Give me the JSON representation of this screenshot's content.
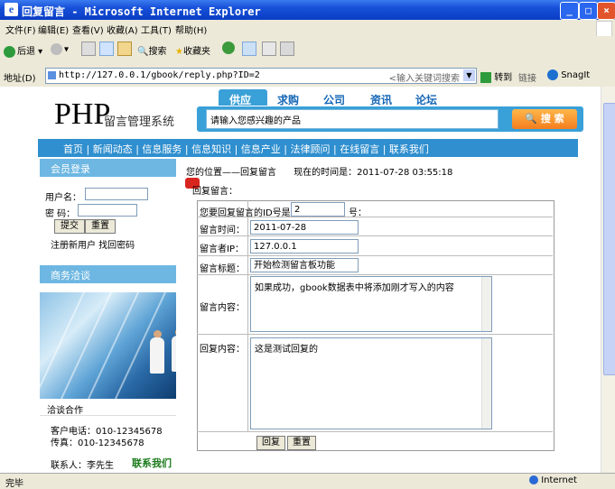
{
  "window": {
    "title": "回复留言 - Microsoft Internet Explorer"
  },
  "menu": [
    "文件(F)",
    "编辑(E)",
    "查看(V)",
    "收藏(A)",
    "工具(T)",
    "帮助(H)"
  ],
  "toolbar": {
    "back": "后退",
    "search": "搜索",
    "favorites": "收藏夹"
  },
  "address": {
    "label": "地址(D)",
    "url": "http://127.0.0.1/gbook/reply.php?ID=2",
    "search_hint": "<输入关键词搜索",
    "go": "转到",
    "links": "链接",
    "snagit": "SnagIt"
  },
  "site": {
    "logo": "PHP",
    "logo_sub": "留言管理系统",
    "tabs": [
      "供应",
      "求购",
      "公司",
      "资讯",
      "论坛"
    ],
    "search_placeholder": "请输入您感兴趣的产品",
    "search_button": "搜 索",
    "nav": "首页 | 新闻动态 | 信息服务 | 信息知识 | 信息产业 | 法律顾问 | 在线留言 | 联系我们"
  },
  "login": {
    "header": "会员登录",
    "username_label": "用户名：",
    "password_label": "密 码：",
    "submit": "提交",
    "reset": "重置",
    "links": "注册新用户 找回密码"
  },
  "business": {
    "header": "商务洽谈",
    "caption": "洽谈合作",
    "phone": "客户电话：010-12345678",
    "fax": "传真：010-12345678",
    "contact": "联系人：李先生",
    "contact_link": "联系我们"
  },
  "main": {
    "breadcrumb": "您的位置——回复留言",
    "time": "现在的时间是：2011-07-28 03:55:18",
    "heading": "回复留言：",
    "fields": {
      "id_label": "您要回复留言的ID号是",
      "id_value": "2",
      "id_suffix": "号：",
      "time_label": "留言时间：",
      "time_value": "2011-07-28",
      "ip_label": "留言者IP：",
      "ip_value": "127.0.0.1",
      "title_label": "留言标题：",
      "title_value": "开始检测留言板功能",
      "content_label": "留言内容：",
      "content_value": "如果成功，gbook数据表中将添加刚才写入的内容",
      "reply_label": "回复内容：",
      "reply_value": "这是测试回复的"
    },
    "reply_button": "回复",
    "reset_button": "重置"
  },
  "status": {
    "left": "完毕",
    "right": "Internet"
  }
}
